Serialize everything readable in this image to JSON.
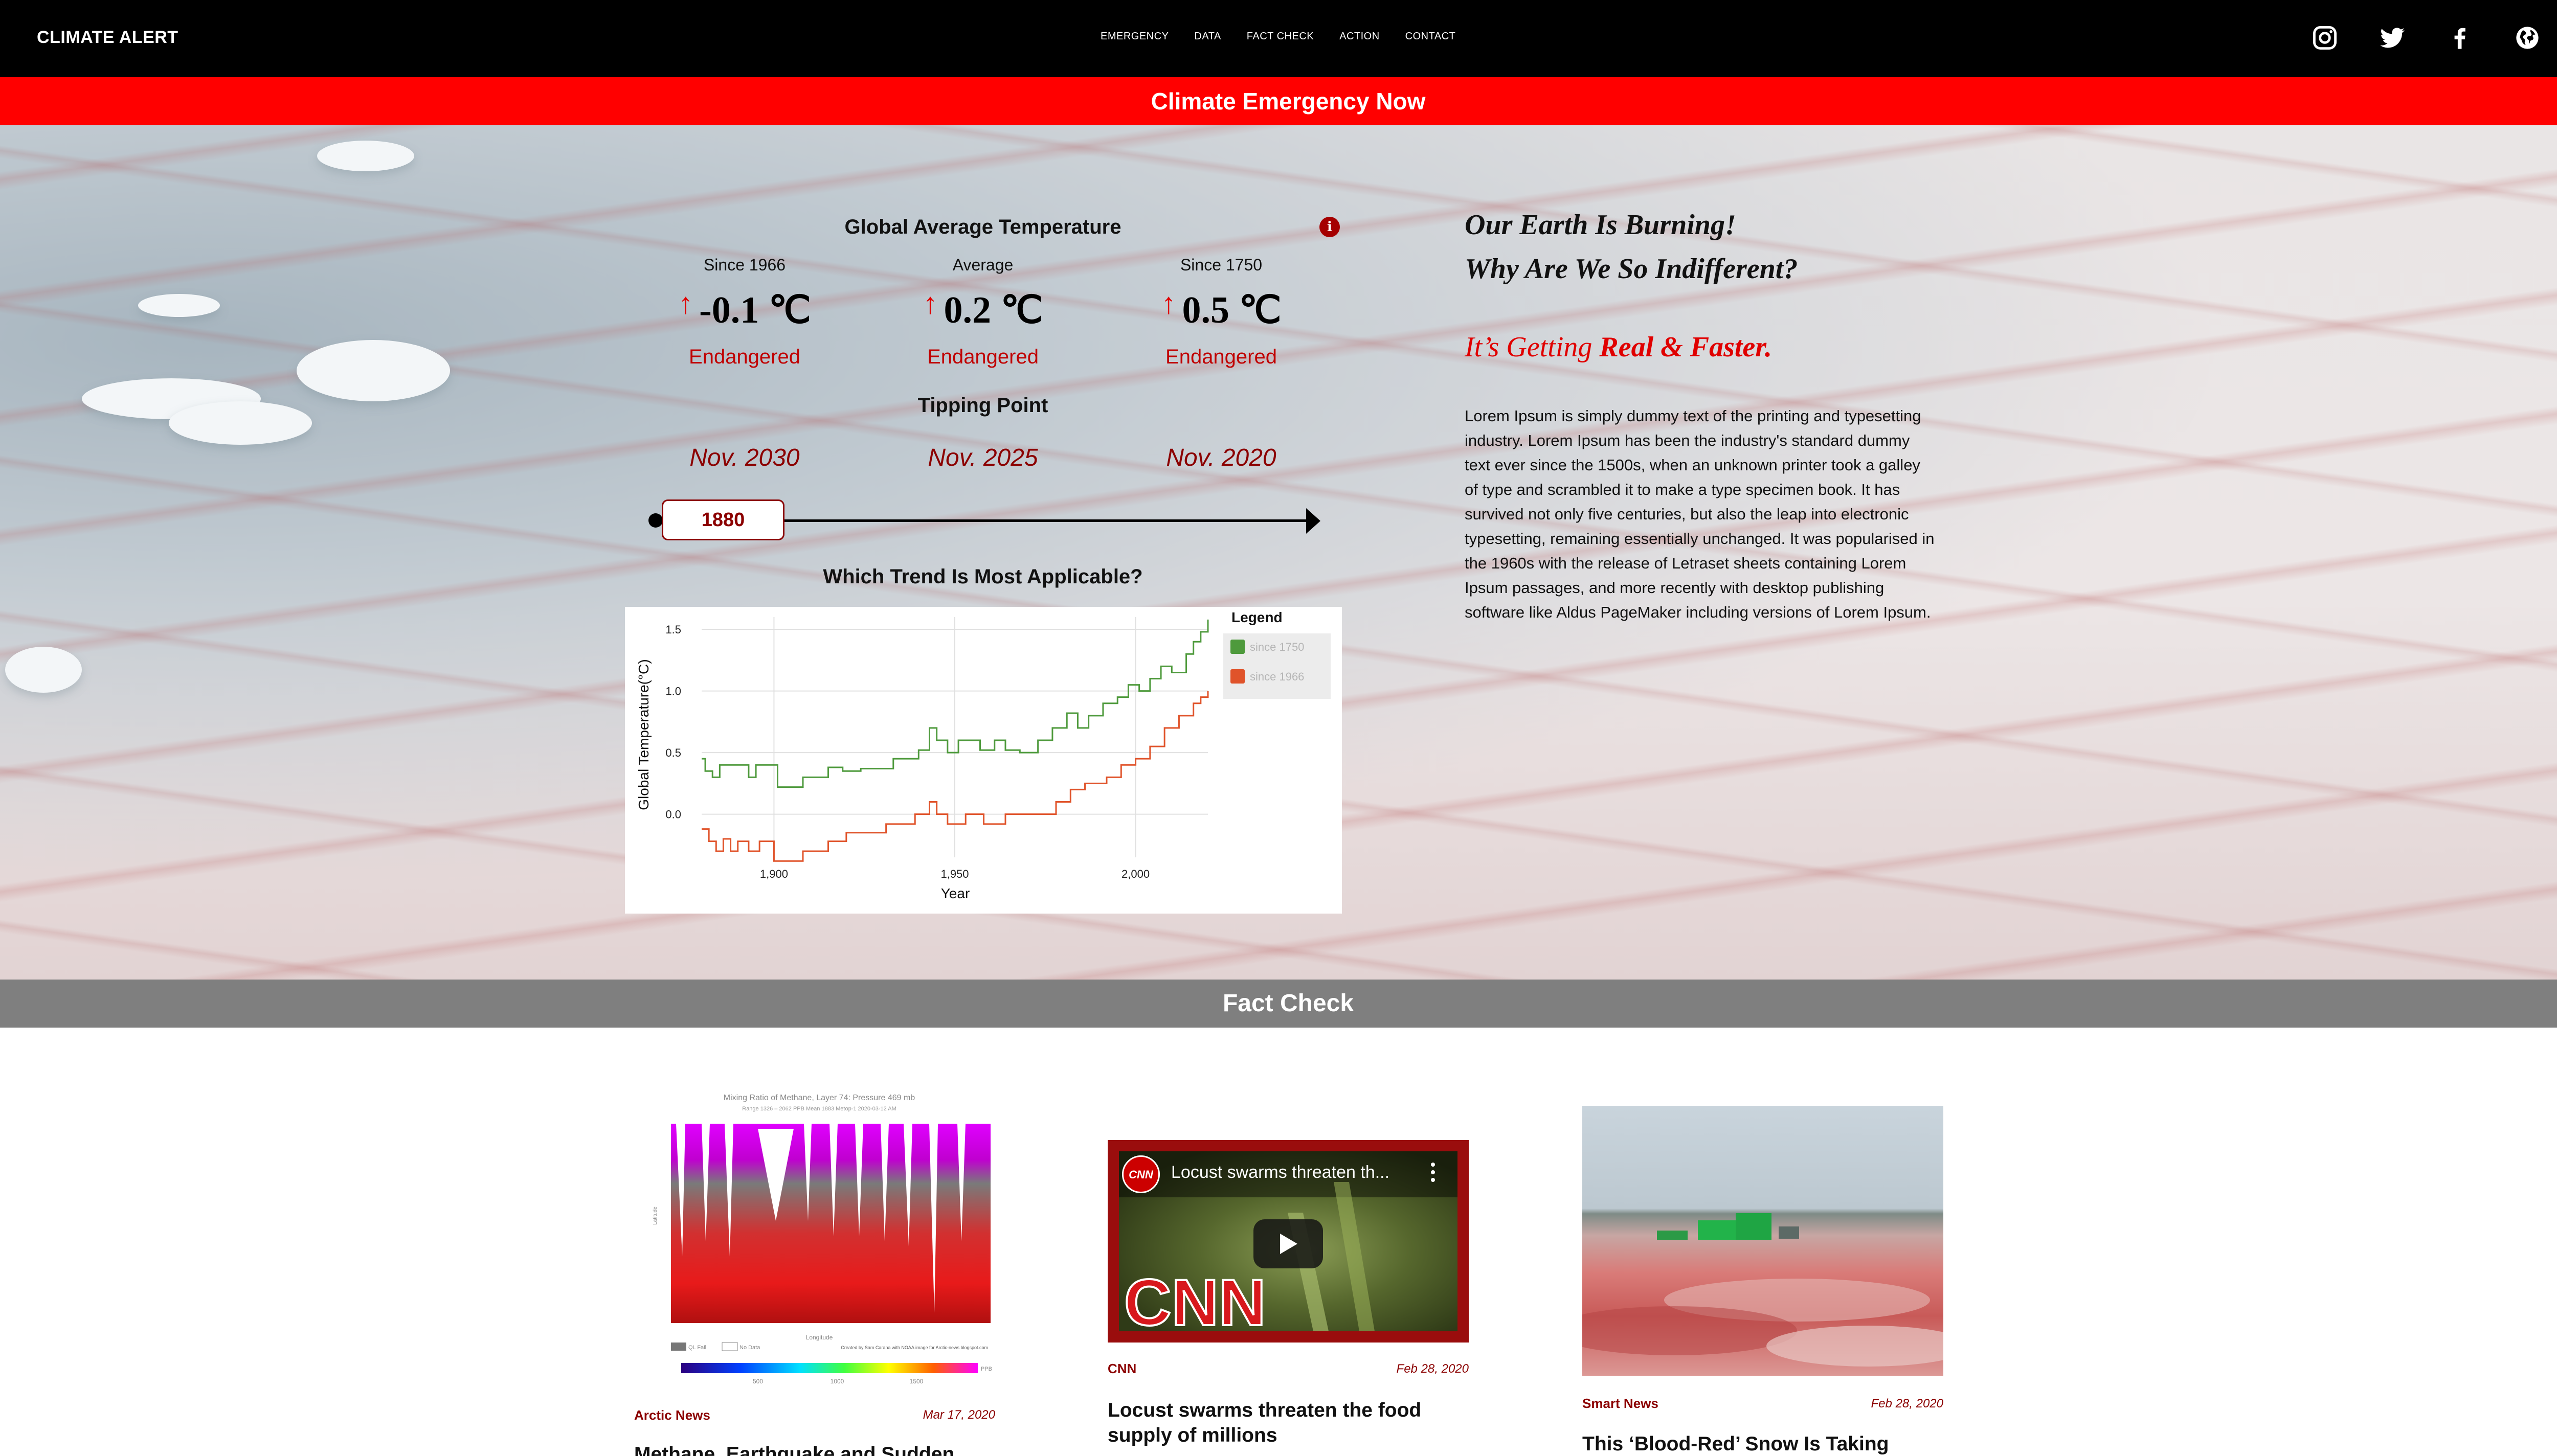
{
  "nav": {
    "brand": "CLIMATE ALERT",
    "links": [
      "EMERGENCY",
      "DATA",
      "FACT CHECK",
      "ACTION",
      "CONTACT"
    ],
    "socials": [
      "instagram-icon",
      "twitter-icon",
      "facebook-icon",
      "globe-icon"
    ]
  },
  "banner": {
    "text": "Climate Emergency Now"
  },
  "temperature": {
    "title": "Global Average Temperature",
    "info_icon": "i",
    "columns": [
      {
        "label": "Since 1966",
        "arrow": "↑",
        "value": "-0.1 ℃",
        "status": "Endangered",
        "tipping_date": "Nov. 2030"
      },
      {
        "label": "Average",
        "arrow": "↑",
        "value": "0.2 ℃",
        "status": "Endangered",
        "tipping_date": "Nov. 2025"
      },
      {
        "label": "Since 1750",
        "arrow": "↑",
        "value": "0.5 ℃",
        "status": "Endangered",
        "tipping_date": "Nov. 2020"
      }
    ],
    "tipping_point_label": "Tipping Point",
    "timeline_year": "1880",
    "trend_question": "Which Trend Is Most Applicable?"
  },
  "chart_data": {
    "type": "line",
    "title": "",
    "xlabel": "Year",
    "ylabel": "Global Temperature(°C)",
    "xlim": [
      1880,
      2020
    ],
    "ylim": [
      -0.35,
      1.6
    ],
    "x_ticks": [
      1900,
      1950,
      2000
    ],
    "x_tick_labels": [
      "1,900",
      "1,950",
      "2,000"
    ],
    "y_ticks": [
      0.0,
      0.5,
      1.0,
      1.5
    ],
    "y_tick_labels": [
      "0.0",
      "0.5",
      "1.0",
      "1.5"
    ],
    "grid": true,
    "legend": {
      "title": "Legend",
      "placement": "right"
    },
    "series": [
      {
        "name": "since 1750",
        "color": "#4e9a3c",
        "x": [
          1880,
          1881,
          1883,
          1885,
          1893,
          1895,
          1901,
          1908,
          1915,
          1919,
          1924,
          1933,
          1940,
          1943,
          1945,
          1948,
          1951,
          1957,
          1961,
          1964,
          1968,
          1973,
          1977,
          1981,
          1984,
          1987,
          1991,
          1995,
          1998,
          2001,
          2004,
          2007,
          2010,
          2014,
          2016,
          2018,
          2020
        ],
        "y": [
          0.45,
          0.35,
          0.3,
          0.4,
          0.3,
          0.4,
          0.22,
          0.3,
          0.38,
          0.35,
          0.37,
          0.45,
          0.52,
          0.7,
          0.6,
          0.5,
          0.6,
          0.52,
          0.6,
          0.52,
          0.5,
          0.6,
          0.7,
          0.82,
          0.7,
          0.8,
          0.9,
          0.95,
          1.05,
          1.0,
          1.1,
          1.2,
          1.15,
          1.3,
          1.4,
          1.48,
          1.58
        ]
      },
      {
        "name": "since 1966",
        "color": "#e0532a",
        "x": [
          1880,
          1882,
          1884,
          1886,
          1888,
          1890,
          1893,
          1896,
          1900,
          1908,
          1915,
          1920,
          1931,
          1939,
          1943,
          1945,
          1948,
          1953,
          1958,
          1964,
          1971,
          1978,
          1982,
          1986,
          1992,
          1996,
          2000,
          2004,
          2008,
          2012,
          2016,
          2018,
          2020
        ],
        "y": [
          -0.12,
          -0.22,
          -0.3,
          -0.2,
          -0.3,
          -0.22,
          -0.3,
          -0.22,
          -0.38,
          -0.3,
          -0.22,
          -0.15,
          -0.08,
          0.0,
          0.1,
          0.0,
          -0.08,
          0.0,
          -0.08,
          0.0,
          0.0,
          0.1,
          0.2,
          0.25,
          0.3,
          0.4,
          0.45,
          0.55,
          0.7,
          0.8,
          0.9,
          0.95,
          1.0
        ]
      }
    ]
  },
  "right_column": {
    "headline_1": "Our Earth Is Burning!",
    "headline_2": "Why Are We So Indifferent?",
    "subhead_prefix": "It’s Getting ",
    "subhead_bold": "Real & Faster.",
    "body": "Lorem Ipsum is simply dummy text of the printing and typesetting industry. Lorem Ipsum has been the industry's standard dummy text ever since the 1500s, when an unknown printer took a galley of type and scrambled it to make a type specimen book. It has survived not only five centuries, but also the leap into electronic typesetting, remaining essentially unchanged. It was popularised in the 1960s with the release of Letraset sheets containing Lorem Ipsum passages, and more recently with desktop publishing software like Aldus PageMaker including versions of Lorem Ipsum."
  },
  "fact_check": {
    "title": "Fact Check",
    "cards": [
      {
        "source": "Arctic News",
        "date": "Mar 17, 2020",
        "title": "Methane, Earthquake and Sudden",
        "image_caption": "Mixing Ratio of Methane, Layer 74: Pressure 469 mb",
        "image_subcaption": "Range 1326 – 2062 PPB          Mean 1883          Metop-1 2020-03-12 AM",
        "image_longitude_label": "Longitude",
        "image_latitude_label": "Latitude",
        "image_scale_ticks": [
          "500",
          "1000",
          "1500"
        ],
        "image_scale_unit": "PPB",
        "image_legend": [
          "QL Fail",
          "No Data"
        ],
        "image_credit": "Created by Sam Carana with NOAA image for Arctic-news.blogspot.com"
      },
      {
        "source": "CNN",
        "date": "Feb 28, 2020",
        "title": "Locust swarms threaten the food supply of millions",
        "video_title": "Locust swarms threaten th...",
        "channel_badge": "CNN",
        "watermark": "CNN"
      },
      {
        "source": "Smart News",
        "date": "Feb 28, 2020",
        "title": "This ‘Blood-Red’ Snow Is Taking"
      }
    ]
  },
  "colors": {
    "nav_bg": "#000000",
    "banner_red": "#ff0000",
    "fact_gray": "#7f7f7f",
    "accent_dark_red": "#8b0000",
    "status_red": "#c00000"
  }
}
